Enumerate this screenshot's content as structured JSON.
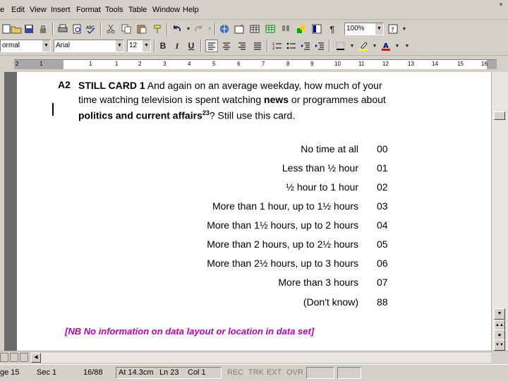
{
  "menu": {
    "items": [
      "e",
      "Edit",
      "View",
      "Insert",
      "Format",
      "Tools",
      "Table",
      "Window",
      "Help"
    ]
  },
  "toolbar": {
    "zoom": "100%",
    "style": "ormal",
    "font": "Arial",
    "size": "12",
    "bold_label": "B",
    "italic_label": "I",
    "underline_label": "U",
    "paragraph_mark": "¶",
    "fill_color": "#ffff00",
    "font_color": "#ff0000"
  },
  "ruler": {
    "numbers": [
      "2",
      "1",
      "1",
      "1",
      "2",
      "3",
      "4",
      "5",
      "6",
      "7",
      "8",
      "9",
      "10",
      "11",
      "12",
      "13",
      "14",
      "15",
      "16",
      "17"
    ]
  },
  "document": {
    "question_number": "A2",
    "question_heading": "STILL CARD 1",
    "question_text_1": " And again on an average weekday, how much of your time watching television is spent watching ",
    "question_bold_1": "news",
    "question_text_2": " or programmes about ",
    "question_bold_2": "politics and current affairs",
    "question_footnote": "23",
    "question_text_3": "? Still use this card.",
    "answers": [
      {
        "label": "No time at all",
        "code": "00"
      },
      {
        "label": "Less than ½ hour",
        "code": "01"
      },
      {
        "label": "½ hour to 1 hour",
        "code": "02"
      },
      {
        "label": "More than 1 hour, up to 1½ hours",
        "code": "03"
      },
      {
        "label": "More than 1½ hours, up to 2 hours",
        "code": "04"
      },
      {
        "label": "More than 2 hours, up to 2½ hours",
        "code": "05"
      },
      {
        "label": "More than 2½ hours, up to 3 hours",
        "code": "06"
      },
      {
        "label": "More than 3 hours",
        "code": "07"
      },
      {
        "label": "(Don't know)",
        "code": "88"
      }
    ],
    "note": "[NB   No information on data layout or location in data set]",
    "note_color": "#c000c0"
  },
  "status": {
    "page": "ge 15",
    "section": "Sec 1",
    "page_of": "16/88",
    "at": "At 14.3cm",
    "line": "Ln 23",
    "col": "Col 1",
    "rec": "REC",
    "trk": "TRK",
    "ext": "EXT",
    "ovr": "OVR"
  }
}
